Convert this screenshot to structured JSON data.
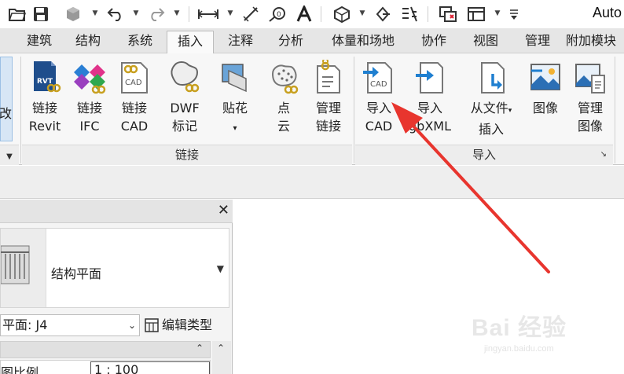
{
  "app": {
    "title": "Auto"
  },
  "tabs": [
    {
      "label": "建筑"
    },
    {
      "label": "结构"
    },
    {
      "label": "系统"
    },
    {
      "label": "插入",
      "active": true
    },
    {
      "label": "注释"
    },
    {
      "label": "分析"
    },
    {
      "label": "体量和场地"
    },
    {
      "label": "协作"
    },
    {
      "label": "视图"
    },
    {
      "label": "管理"
    },
    {
      "label": "附加模块"
    }
  ],
  "ribbon": {
    "partial_label": "改",
    "buttons": [
      {
        "line1": "链接",
        "line2": "Revit",
        "icon": "link-revit-icon"
      },
      {
        "line1": "链接",
        "line2": "IFC",
        "icon": "link-ifc-icon"
      },
      {
        "line1": "链接",
        "line2": "CAD",
        "icon": "link-cad-icon"
      },
      {
        "line1": "DWF",
        "line2": "标记",
        "icon": "dwf-markup-icon"
      },
      {
        "line1": "贴花",
        "line2": "▾",
        "icon": "decal-icon"
      },
      {
        "line1": "点",
        "line2": "云",
        "icon": "point-cloud-icon"
      },
      {
        "line1": "管理",
        "line2": "链接",
        "icon": "manage-links-icon"
      },
      {
        "line1": "导入",
        "line2": "CAD",
        "icon": "import-cad-icon"
      },
      {
        "line1": "导入",
        "line2": "gbXML",
        "icon": "import-gbxml-icon"
      },
      {
        "line1": "从文件",
        "line2": "插入",
        "icon": "insert-from-file-icon"
      },
      {
        "line1": "图像",
        "line2": "",
        "icon": "image-icon"
      },
      {
        "line1": "管理",
        "line2": "图像",
        "icon": "manage-images-icon"
      }
    ],
    "panels": [
      {
        "label": "链接"
      },
      {
        "label": "导入"
      }
    ]
  },
  "properties": {
    "type_name": "结构平面",
    "view_selector": "平面: J4",
    "edit_type": "编辑类型",
    "prop_label": "图比例",
    "prop_value": "1 : 100"
  },
  "watermark": {
    "text": "Bai 经验",
    "sub": "jingyan.baidu.com"
  },
  "colors": {
    "arrow": "#e8352e",
    "tab_bar": "#e6e6e6",
    "ribbon": "#f7f7f7"
  }
}
